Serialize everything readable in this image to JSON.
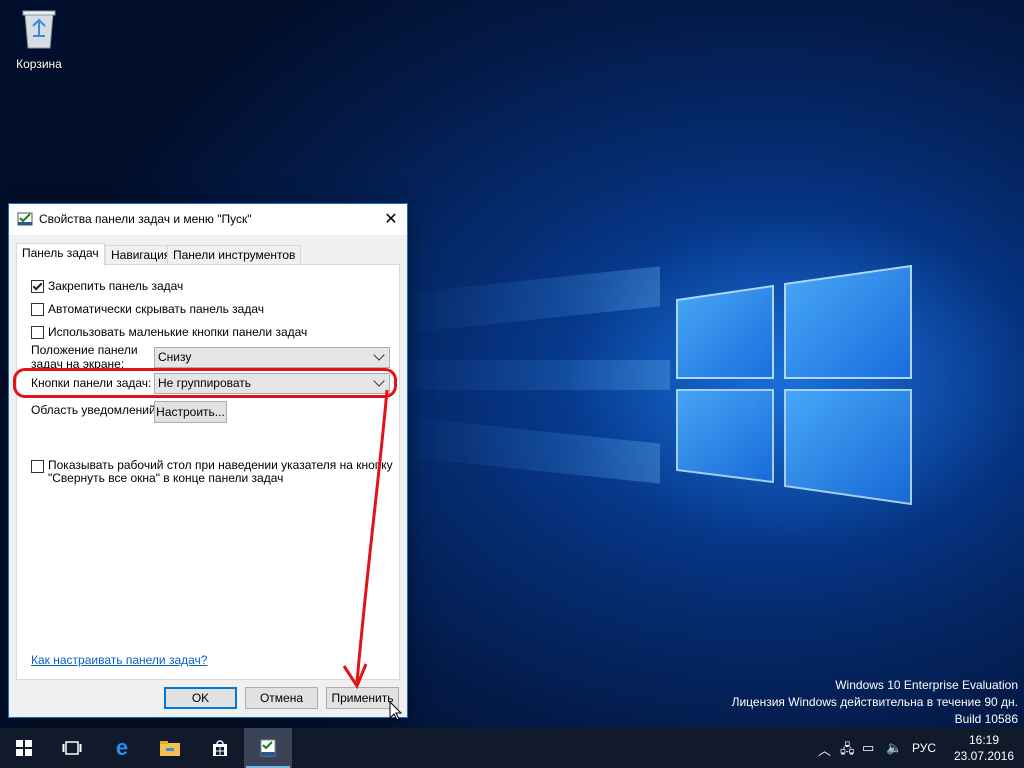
{
  "desktop": {
    "recycle_bin_label": "Корзина",
    "watermark": {
      "line1": "Windows 10 Enterprise Evaluation",
      "line2": "Лицензия Windows действительна в течение 90 дн.",
      "line3": "Build 10586"
    }
  },
  "dialog": {
    "title": "Свойства панели задач и меню \"Пуск\"",
    "tabs": [
      {
        "label": "Панель задач",
        "active": true
      },
      {
        "label": "Навигация",
        "active": false
      },
      {
        "label": "Панели инструментов",
        "active": false
      }
    ],
    "lock_taskbar": {
      "label": "Закрепить панель задач",
      "checked": true
    },
    "auto_hide": {
      "label": "Автоматически скрывать панель задач",
      "checked": false
    },
    "small_buttons": {
      "label": "Использовать маленькие кнопки панели задач",
      "checked": false
    },
    "position": {
      "label_line1": "Положение панели",
      "label_line2": "задач на экране:",
      "value": "Снизу"
    },
    "buttons_combine": {
      "label": "Кнопки панели задач:",
      "value": "Не группировать"
    },
    "notification_area": {
      "label": "Область уведомлений:",
      "button": "Настроить..."
    },
    "peek": {
      "label_line1": "Показывать рабочий стол при наведении указателя на кнопку",
      "label_line2": "\"Свернуть все окна\" в конце панели задач",
      "checked": false
    },
    "help_link": "Как настраивать панели задач?",
    "ok": "OK",
    "cancel": "Отмена",
    "apply": "Применить"
  },
  "annotation": {
    "color": "#e3121a"
  },
  "taskbar": {
    "language": "РУС",
    "time": "16:19",
    "date": "23.07.2016",
    "accent": "#76b9ed",
    "items": [
      "start-icon",
      "task-view-icon",
      "edge-icon",
      "file-explorer-icon",
      "store-icon",
      "taskbar-properties-icon"
    ]
  }
}
